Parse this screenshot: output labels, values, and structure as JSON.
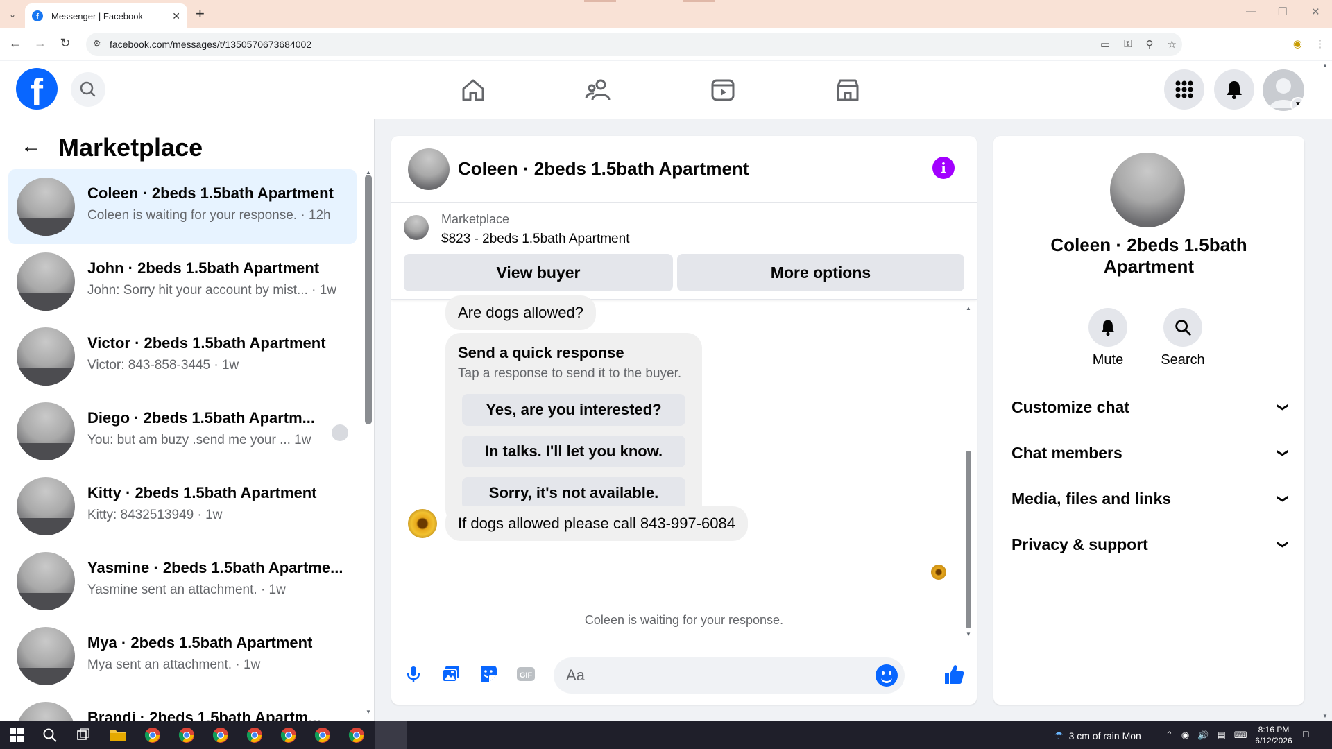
{
  "browser": {
    "tab_title": "Messenger | Facebook",
    "url": "facebook.com/messages/t/1350570673684002"
  },
  "left": {
    "title": "Marketplace",
    "conversations": [
      {
        "name": "Coleen · 2beds 1.5bath Apartment",
        "snippet": "Coleen is waiting for your response. · 12h",
        "active": true
      },
      {
        "name": "John · 2beds 1.5bath Apartment",
        "snippet": "John: Sorry hit your account by mist... · 1w"
      },
      {
        "name": "Victor · 2beds 1.5bath Apartment",
        "snippet": "Victor: 843-858-3445 · 1w"
      },
      {
        "name": "Diego · 2beds 1.5bath Apartm...",
        "snippet": "You: but am buzy .send me your ...  1w"
      },
      {
        "name": "Kitty · 2beds 1.5bath Apartment",
        "snippet": "Kitty: 8432513949 · 1w"
      },
      {
        "name": "Yasmine · 2beds 1.5bath Apartme...",
        "snippet": "Yasmine sent an attachment. · 1w"
      },
      {
        "name": "Mya · 2beds 1.5bath Apartment",
        "snippet": "Mya sent an attachment. · 1w"
      },
      {
        "name": "Brandi · 2beds 1.5bath Apartm...",
        "snippet": ""
      }
    ]
  },
  "chat": {
    "title": "Coleen · 2beds 1.5bath Apartment",
    "listing_label": "Marketplace",
    "listing_price": "$823 - 2beds 1.5bath Apartment",
    "view_buyer": "View buyer",
    "more_options": "More options",
    "msg_dogs": "Are dogs allowed?",
    "quick_title": "Send a quick response",
    "quick_sub": "Tap a response to send it to the buyer.",
    "quick_replies": [
      "Yes, are you interested?",
      "In talks. I'll let you know.",
      "Sorry, it's not available."
    ],
    "msg_call": "If dogs allowed please call 843-997-6084",
    "waiting": "Coleen is waiting for your response.",
    "input_placeholder": "Aa"
  },
  "right": {
    "name": "Coleen · 2beds 1.5bath Apartment",
    "mute": "Mute",
    "search": "Search",
    "sections": [
      "Customize chat",
      "Chat members",
      "Media, files and links",
      "Privacy & support"
    ]
  },
  "taskbar": {
    "weather": "3 cm of rain Mon",
    "time": "8:16 PM",
    "date": "6/12/2026"
  },
  "icons": {
    "brand_color": "#0866ff",
    "info_color": "#a200ff"
  }
}
